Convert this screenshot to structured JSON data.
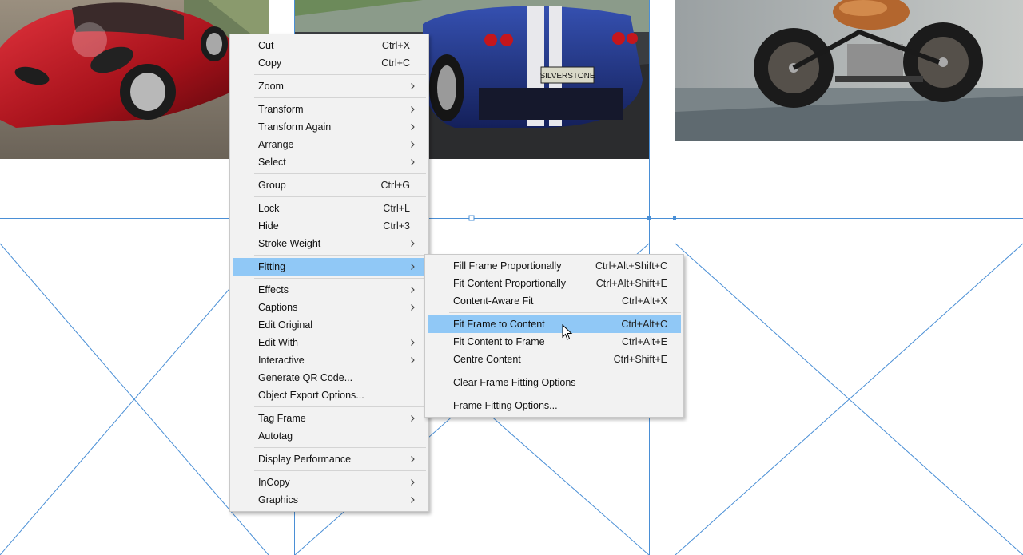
{
  "context_menu": {
    "items": [
      {
        "type": "item",
        "label": "Cut",
        "shortcut": "Ctrl+X"
      },
      {
        "type": "item",
        "label": "Copy",
        "shortcut": "Ctrl+C"
      },
      {
        "type": "sep"
      },
      {
        "type": "item",
        "label": "Zoom",
        "submenu": true
      },
      {
        "type": "sep"
      },
      {
        "type": "item",
        "label": "Transform",
        "submenu": true
      },
      {
        "type": "item",
        "label": "Transform Again",
        "submenu": true
      },
      {
        "type": "item",
        "label": "Arrange",
        "submenu": true
      },
      {
        "type": "item",
        "label": "Select",
        "submenu": true
      },
      {
        "type": "sep"
      },
      {
        "type": "item",
        "label": "Group",
        "shortcut": "Ctrl+G"
      },
      {
        "type": "sep"
      },
      {
        "type": "item",
        "label": "Lock",
        "shortcut": "Ctrl+L"
      },
      {
        "type": "item",
        "label": "Hide",
        "shortcut": "Ctrl+3"
      },
      {
        "type": "item",
        "label": "Stroke Weight",
        "submenu": true
      },
      {
        "type": "sep"
      },
      {
        "type": "item",
        "label": "Fitting",
        "submenu": true,
        "highlighted": true
      },
      {
        "type": "sep"
      },
      {
        "type": "item",
        "label": "Effects",
        "submenu": true
      },
      {
        "type": "item",
        "label": "Captions",
        "submenu": true
      },
      {
        "type": "item",
        "label": "Edit Original"
      },
      {
        "type": "item",
        "label": "Edit With",
        "submenu": true
      },
      {
        "type": "item",
        "label": "Interactive",
        "submenu": true
      },
      {
        "type": "item",
        "label": "Generate QR Code..."
      },
      {
        "type": "item",
        "label": "Object Export Options..."
      },
      {
        "type": "sep"
      },
      {
        "type": "item",
        "label": "Tag Frame",
        "submenu": true
      },
      {
        "type": "item",
        "label": "Autotag"
      },
      {
        "type": "sep"
      },
      {
        "type": "item",
        "label": "Display Performance",
        "submenu": true
      },
      {
        "type": "sep"
      },
      {
        "type": "item",
        "label": "InCopy",
        "submenu": true
      },
      {
        "type": "item",
        "label": "Graphics",
        "submenu": true
      }
    ]
  },
  "fitting_submenu": {
    "items": [
      {
        "type": "item",
        "label": "Fill Frame Proportionally",
        "shortcut": "Ctrl+Alt+Shift+C"
      },
      {
        "type": "item",
        "label": "Fit Content Proportionally",
        "shortcut": "Ctrl+Alt+Shift+E"
      },
      {
        "type": "item",
        "label": "Content-Aware Fit",
        "shortcut": "Ctrl+Alt+X"
      },
      {
        "type": "sep"
      },
      {
        "type": "item",
        "label": "Fit Frame to Content",
        "shortcut": "Ctrl+Alt+C",
        "highlighted": true
      },
      {
        "type": "item",
        "label": "Fit Content to Frame",
        "shortcut": "Ctrl+Alt+E"
      },
      {
        "type": "item",
        "label": "Centre Content",
        "shortcut": "Ctrl+Shift+E"
      },
      {
        "type": "sep"
      },
      {
        "type": "item",
        "label": "Clear Frame Fitting Options"
      },
      {
        "type": "sep"
      },
      {
        "type": "item",
        "label": "Frame Fitting Options..."
      }
    ]
  },
  "images": {
    "license_plate": "SILVERSTONE"
  },
  "colors": {
    "guide": "#4a8fd6",
    "menu_bg": "#f2f2f2",
    "highlight": "#90c8f6"
  },
  "icons": {
    "submenu_arrow": "chevron-right-icon",
    "cursor": "mouse-pointer-icon"
  }
}
